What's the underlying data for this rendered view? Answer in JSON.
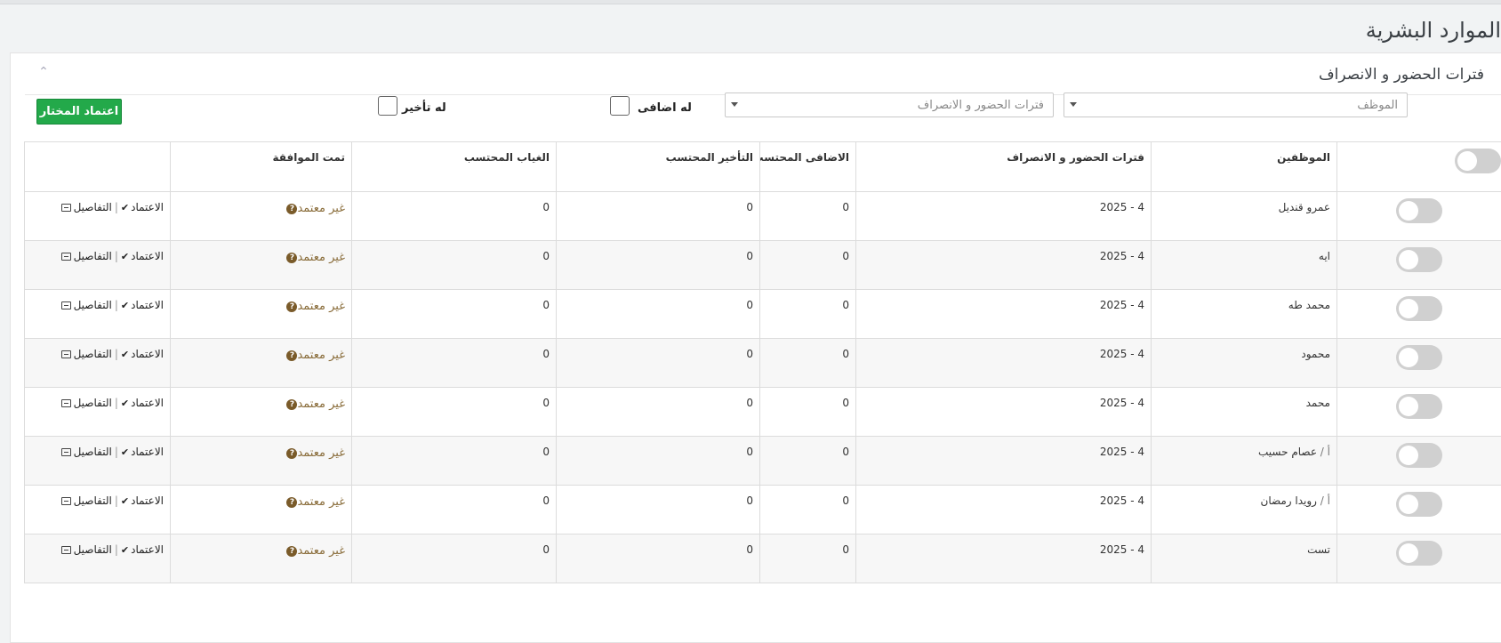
{
  "page": {
    "title": "الموارد البشرية"
  },
  "panel": {
    "title": "فترات الحضور و الانصراف"
  },
  "filters": {
    "employee_placeholder": "الموظف",
    "period_placeholder": "فترات الحضور و الانصراف",
    "overtime_label": "له اضافى",
    "late_label": "له تأخير",
    "approve_selected_label": "اعتماد المختار"
  },
  "table": {
    "headers": {
      "employees": "الموظفين",
      "periods": "فترات الحضور و الانصراف",
      "overtime": "الاضافى المحتسب",
      "late": "التأخير المحتسب",
      "absence": "الغياب المحتسب",
      "approved": "تمت الموافقة"
    },
    "rows": [
      {
        "prefix": "",
        "name": "عمرو قنديل",
        "period": "4 - 2025",
        "overtime": "0",
        "late": "0",
        "absence": "0",
        "status": "غير معتمد"
      },
      {
        "prefix": "",
        "name": "ايه",
        "period": "4 - 2025",
        "overtime": "0",
        "late": "0",
        "absence": "0",
        "status": "غير معتمد"
      },
      {
        "prefix": "",
        "name": "محمد طه",
        "period": "4 - 2025",
        "overtime": "0",
        "late": "0",
        "absence": "0",
        "status": "غير معتمد"
      },
      {
        "prefix": "",
        "name": "محمود",
        "period": "4 - 2025",
        "overtime": "0",
        "late": "0",
        "absence": "0",
        "status": "غير معتمد"
      },
      {
        "prefix": "",
        "name": "محمد",
        "period": "4 - 2025",
        "overtime": "0",
        "late": "0",
        "absence": "0",
        "status": "غير معتمد"
      },
      {
        "prefix": "أ / ",
        "name": "عصام حسيب",
        "period": "4 - 2025",
        "overtime": "0",
        "late": "0",
        "absence": "0",
        "status": "غير معتمد"
      },
      {
        "prefix": "أ / ",
        "name": "رويدا رمضان",
        "period": "4 - 2025",
        "overtime": "0",
        "late": "0",
        "absence": "0",
        "status": "غير معتمد"
      },
      {
        "prefix": "",
        "name": "تست",
        "period": "4 - 2025",
        "overtime": "0",
        "late": "0",
        "absence": "0",
        "status": "غير معتمد"
      }
    ],
    "actions": {
      "approve_label": "الاعتماد",
      "separator": "|",
      "details_label": "التفاصيل"
    }
  },
  "colors": {
    "approve_button": "#23a94a",
    "status_text": "#8a6d3b"
  }
}
